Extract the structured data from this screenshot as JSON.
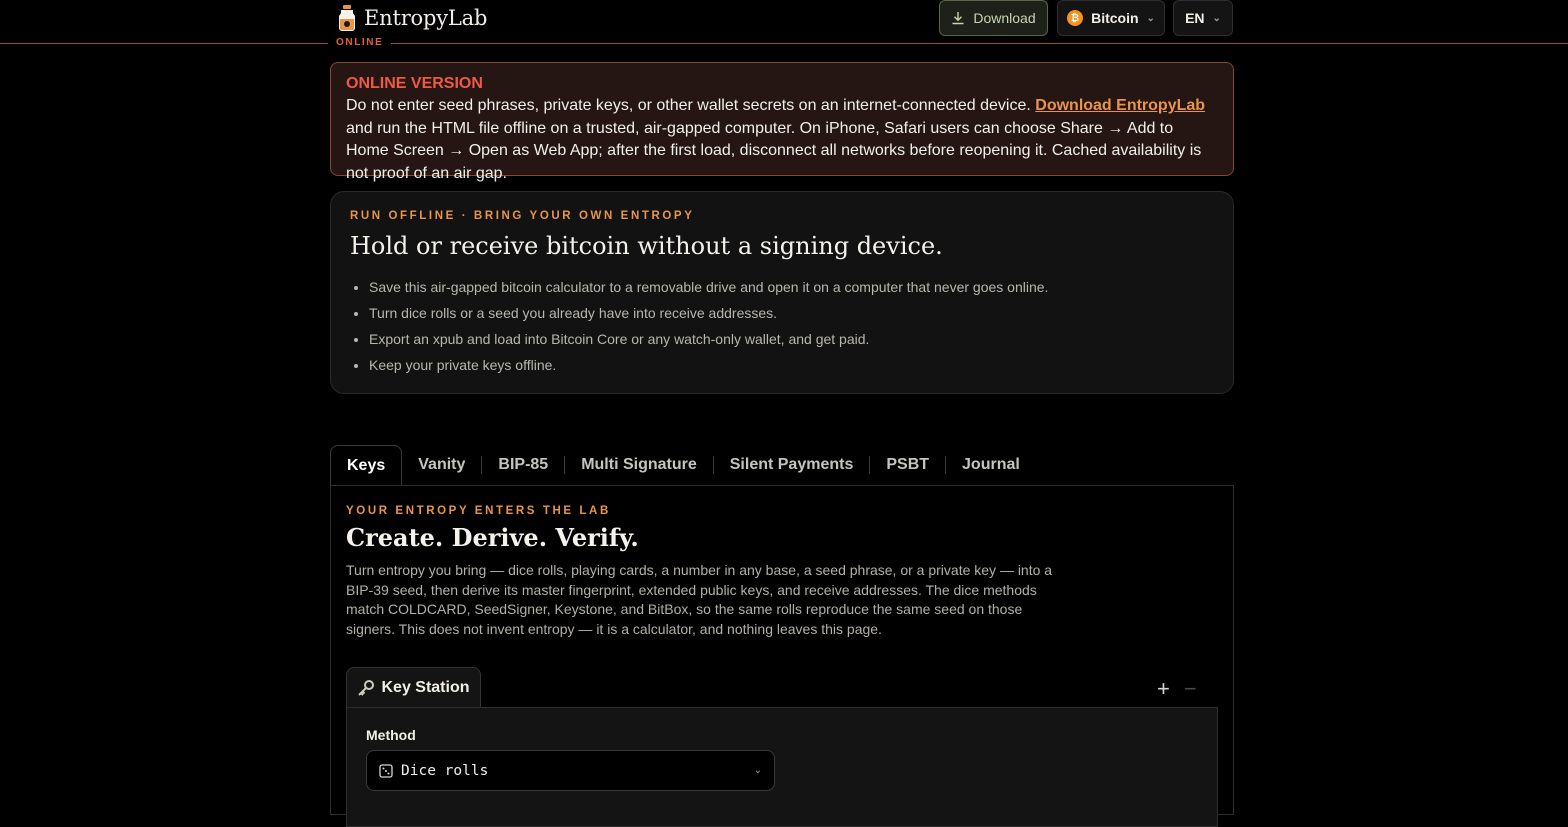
{
  "brand": {
    "name": "EntropyLab",
    "mode": "ONLINE"
  },
  "header": {
    "download_label": "Download",
    "chain_label": "Bitcoin",
    "chain_icon": "₿",
    "lang_label": "EN"
  },
  "warning": {
    "title": "ONLINE VERSION",
    "text_before": "Do not enter seed phrases, private keys, or other wallet secrets on an internet-connected device. ",
    "link": "Download EntropyLab",
    "text_after": " and run the HTML file offline on a trusted, air-gapped computer. On iPhone, Safari users can choose Share → Add to Home Screen → Open as Web App; after the first load, disconnect all networks before reopening it. Cached availability is not proof of an air gap."
  },
  "hero": {
    "eyebrow": "RUN OFFLINE · BRING YOUR OWN ENTROPY",
    "title": "Hold or receive bitcoin without a signing device.",
    "bullets": [
      "Save this air-gapped bitcoin calculator to a removable drive and open it on a computer that never goes online.",
      "Turn dice rolls or a seed you already have into receive addresses.",
      "Export an xpub and load into Bitcoin Core or any watch-only wallet, and get paid.",
      "Keep your private keys offline."
    ]
  },
  "tabs": [
    "Keys",
    "Vanity",
    "BIP-85",
    "Multi Signature",
    "Silent Payments",
    "PSBT",
    "Journal"
  ],
  "keys_panel": {
    "eyebrow": "YOUR ENTROPY ENTERS THE LAB",
    "title": "Create. Derive. Verify.",
    "description": "Turn entropy you bring — dice rolls, playing cards, a number in any base, a seed phrase, or a private key — into a BIP-39 seed, then derive its master fingerprint, extended public keys, and receive addresses. The dice methods match COLDCARD, SeedSigner, Keystone, and BitBox, so the same rolls reproduce the same seed on those signers. This does not invent entropy — it is a calculator, and nothing leaves this page."
  },
  "station": {
    "title": "Key Station",
    "add_label": "+",
    "remove_label": "−",
    "method_label": "Method",
    "method_value": "Dice rolls"
  },
  "colors": {
    "accent": "#e8954a",
    "warning": "#ee5a44",
    "brand_bitcoin": "#f7931a"
  }
}
